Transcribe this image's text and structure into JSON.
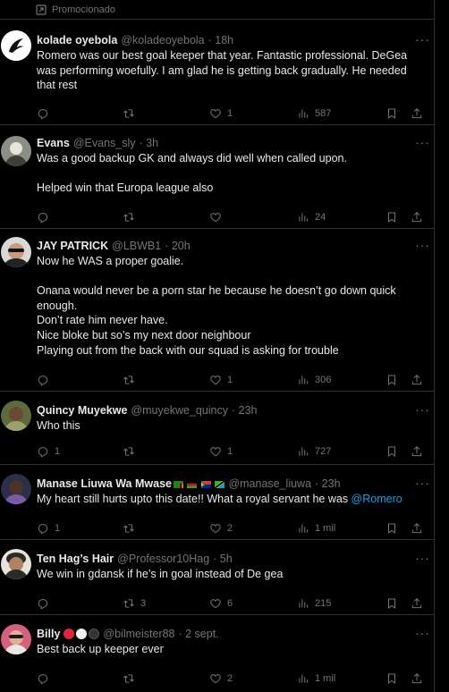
{
  "promo": {
    "label": "Promocionado"
  },
  "tweets": [
    {
      "name": "kolade oyebola",
      "handle": "@koladeoyebola",
      "time": "· 18h",
      "text": "Romero was our best goal keeper that year. Fantastic professional. DeGea was performing woefully. I am glad he is getting back gradually. He needed that rest",
      "replies": "",
      "retweets": "",
      "likes": "1",
      "views": "587"
    },
    {
      "name": "Evans",
      "handle": "@Evans_sly",
      "time": "· 3h",
      "text": "Was a good backup GK and always did well when called upon.\n\nHelped win that Europa league also",
      "replies": "",
      "retweets": "",
      "likes": "",
      "views": "24"
    },
    {
      "name": "JAY PATRICK",
      "handle": "@LBWB1",
      "time": "· 20h",
      "text": "Now he WAS a proper goalie.\n\nOnana would never be a porn star he because he doesn’t go down quick enough.\nDon’t rate him never have.\nNice bloke but so’s my next door neighbour\nPlaying out from the back with our squad is asking for trouble",
      "replies": "",
      "retweets": "",
      "likes": "1",
      "views": "306"
    },
    {
      "name": "Quincy Muyekwe",
      "handle": "@muyekwe_quincy",
      "time": "· 23h",
      "text": "Who this",
      "replies": "1",
      "retweets": "",
      "likes": "1",
      "views": "727"
    },
    {
      "name": "Manase Liuwa Wa Mwase",
      "handle": "@manase_liuwa",
      "time": "· 23h",
      "text_pre": "My heart still hurts upto this date!! What a royal servant he was ",
      "mention": "@Romero",
      "replies": "1",
      "retweets": "",
      "likes": "2",
      "views": "1 mil"
    },
    {
      "name": "Ten Hag’s Hair",
      "handle": "@Professor10Hag",
      "time": "· 5h",
      "text": "We win in gdansk if he’s in goal instead of De gea",
      "replies": "",
      "retweets": "3",
      "likes": "6",
      "views": "215"
    },
    {
      "name": "Billy",
      "handle": "@bilmeister88",
      "time": "· 2 sept.",
      "text": "Best back up keeper ever",
      "replies": "",
      "retweets": "",
      "likes": "2",
      "views": "1 mil"
    }
  ],
  "icons": {
    "reply": "speech-bubble-icon",
    "retweet": "retweet-icon",
    "like": "heart-icon",
    "views": "bar-chart-icon",
    "bookmark": "bookmark-icon",
    "share": "share-icon",
    "more": "more-dots-icon"
  },
  "colors": {
    "background": "#000000",
    "text": "#e7e9ea",
    "muted": "#71767b",
    "link": "#1d9bf0",
    "divider": "#2f3336"
  }
}
